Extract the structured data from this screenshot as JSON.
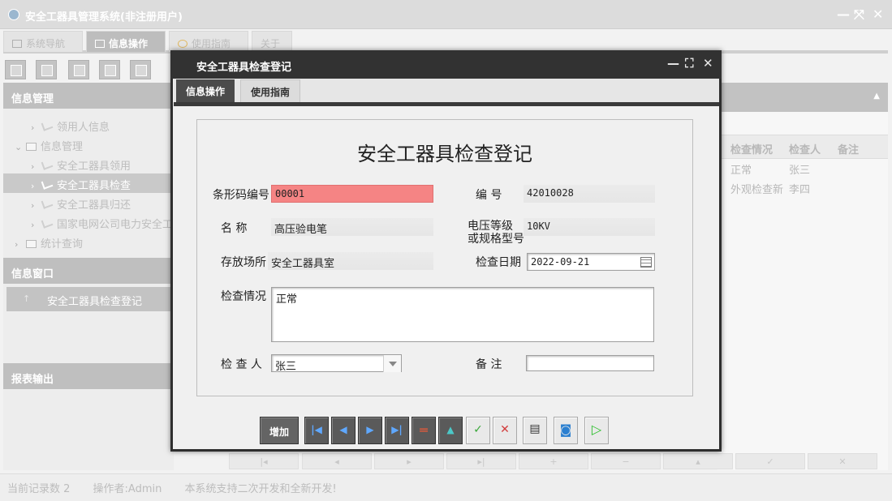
{
  "app": {
    "title": "安全工器具管理系统(非注册用户)",
    "window_controls": [
      "minimize-icon",
      "maximize-icon",
      "close-icon"
    ]
  },
  "main_tabs": [
    {
      "label": "系统导航",
      "icon": "monitor-icon"
    },
    {
      "label": "信息操作",
      "icon": "grid-icon",
      "active": true
    },
    {
      "label": "使用指南",
      "icon": "help-icon"
    },
    {
      "label": "关于"
    }
  ],
  "left_panel": {
    "info_header": "信息管理",
    "tree": [
      {
        "label": "领用人信息",
        "level": 2
      },
      {
        "label": "信息管理",
        "level": 1,
        "expanded": true
      },
      {
        "label": "安全工器具领用",
        "level": 2
      },
      {
        "label": "安全工器具检查",
        "level": 2,
        "selected": true
      },
      {
        "label": "安全工器具归还",
        "level": 2
      },
      {
        "label": "国家电网公司电力安全工",
        "level": 2
      },
      {
        "label": "统计查询",
        "level": 1
      }
    ],
    "window_header": "信息窗口",
    "window_item": "安全工器具检查登记",
    "report_header": "报表输出"
  },
  "grid": {
    "columns": [
      "检查情况",
      "检查人",
      "备注"
    ],
    "rows": [
      [
        "正常",
        "张三",
        ""
      ],
      [
        "外观检查新",
        "李四",
        ""
      ]
    ]
  },
  "status_bar": {
    "record_count": "当前记录数 2",
    "operator": "操作者:Admin",
    "message": "本系统支持二次开发和全新开发!"
  },
  "dialog": {
    "title": "安全工器具检查登记",
    "tabs": [
      {
        "label": "信息操作",
        "active": true
      },
      {
        "label": "使用指南"
      }
    ],
    "form_title": "安全工器具检查登记",
    "fields": {
      "barcode": {
        "label": "条形码编号",
        "value": "00001"
      },
      "number": {
        "label": "编 号",
        "value": "42010028"
      },
      "name": {
        "label": "名 称",
        "value": "高压验电笔"
      },
      "voltage": {
        "label_line1": "电压等级",
        "label_line2": "或规格型号",
        "value": "10KV"
      },
      "location": {
        "label": "存放场所",
        "value": "安全工器具室"
      },
      "check_date": {
        "label": "检查日期",
        "value": "2022-09-21"
      },
      "check_status": {
        "label": "检查情况",
        "value": "正常"
      },
      "inspector": {
        "label": "检 查 人",
        "value": "张三"
      },
      "remark": {
        "label": "备 注",
        "value": ""
      }
    },
    "buttons": {
      "add": "增加",
      "nav": [
        "first-record-icon",
        "prev-record-icon",
        "next-record-icon",
        "last-record-icon"
      ],
      "actions": [
        "delete-icon",
        "edit-icon",
        "confirm-icon",
        "cancel-icon",
        "print-icon",
        "preview-icon",
        "run-icon"
      ]
    }
  },
  "colors": {
    "barcode_highlight": "#f58484",
    "dialog_title_bg": "#323232",
    "active_tab_bg": "#4b4b4b",
    "confirm_green": "#3aa83a",
    "cancel_red": "#d23c3c",
    "run_green": "#2fbf2f"
  }
}
